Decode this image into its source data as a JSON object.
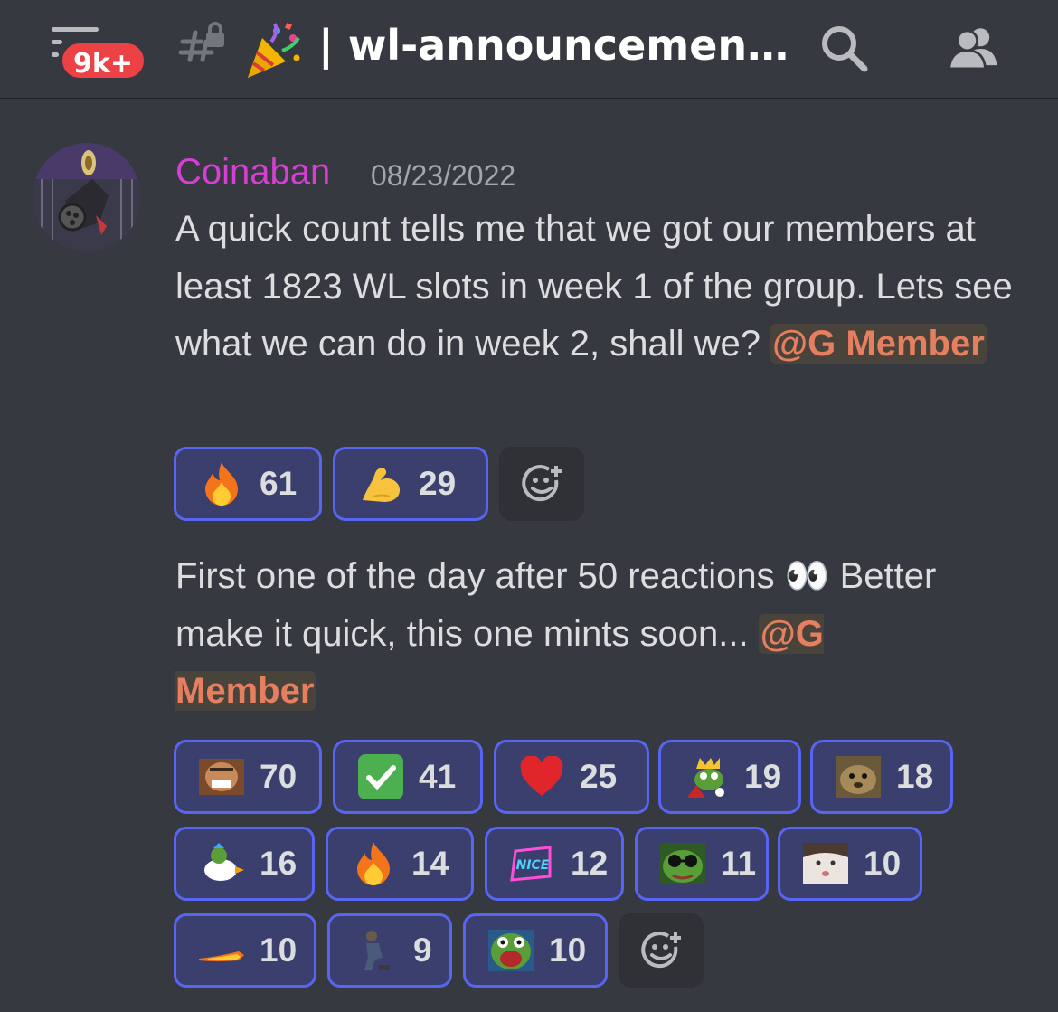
{
  "header": {
    "badge": "9k+",
    "channel_name": "| wl-announcemen…",
    "icons": [
      "menu-icon",
      "locked-channel-hash-icon",
      "party-popper-emoji",
      "search-icon",
      "members-icon"
    ]
  },
  "message1": {
    "author": "Coinaban",
    "author_color": "#d63fd3",
    "timestamp": "08/23/2022",
    "text": "A quick count tells me that we got our members at least 1823 WL slots in week 1 of the group. Lets see what we can do in week 2, shall we? ",
    "mention": "@G Member",
    "reactions": [
      {
        "emoji": "fire",
        "count": "61"
      },
      {
        "emoji": "flexed-biceps",
        "count": "29"
      }
    ]
  },
  "message2": {
    "text": "First one of the day after 50 reactions 👀 Better make it quick, this one mints soon... ",
    "mention_part1": "@G",
    "mention_part2": "Member",
    "reactions": [
      {
        "emoji": "laughing-man",
        "count": "70"
      },
      {
        "emoji": "check-mark",
        "count": "41"
      },
      {
        "emoji": "red-heart",
        "count": "25"
      },
      {
        "emoji": "pepe-king",
        "count": "19"
      },
      {
        "emoji": "dog-face",
        "count": "18"
      },
      {
        "emoji": "pepe-duck",
        "count": "16"
      },
      {
        "emoji": "fire",
        "count": "14"
      },
      {
        "emoji": "nice-text",
        "count": "12"
      },
      {
        "emoji": "pepe-sunglasses",
        "count": "11"
      },
      {
        "emoji": "girl-face",
        "count": "10"
      },
      {
        "emoji": "rocket-trail",
        "count": "10"
      },
      {
        "emoji": "kneeling-man",
        "count": "9"
      },
      {
        "emoji": "pepe-scream",
        "count": "10"
      }
    ]
  },
  "colors": {
    "background": "#36393f",
    "reaction_border": "#5865f2",
    "reaction_bg": "#3b3f6e",
    "mention": "#e67e60",
    "badge": "#ed4245"
  }
}
